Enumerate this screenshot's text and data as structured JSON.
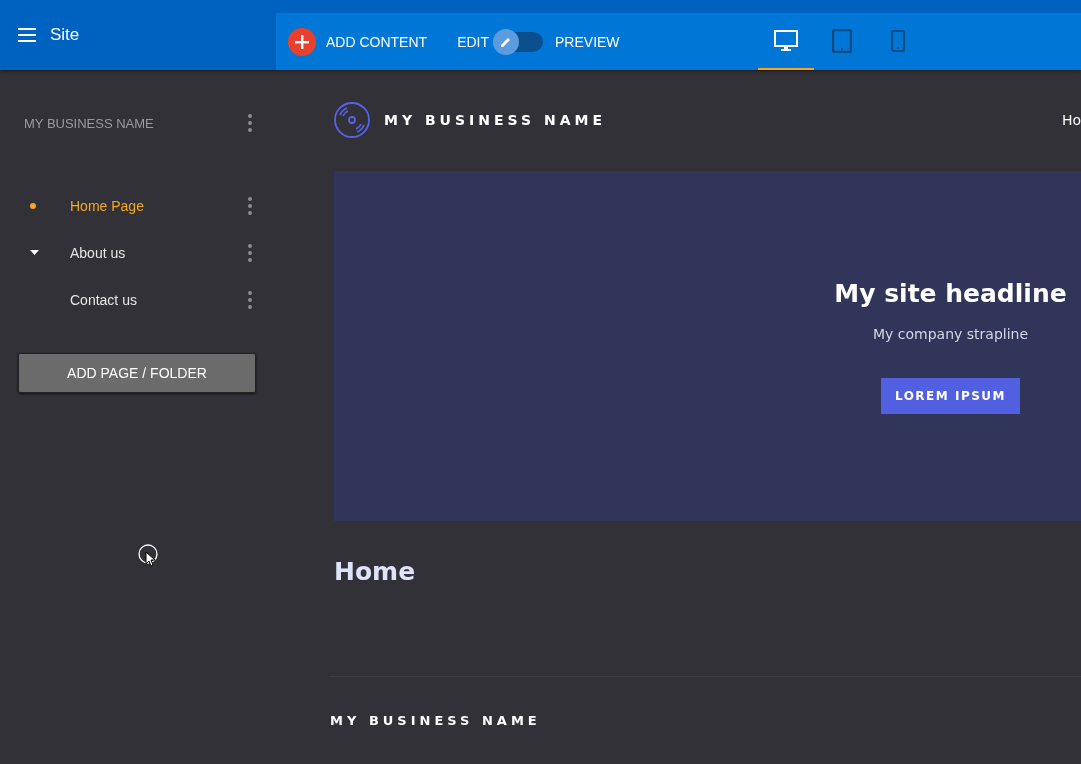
{
  "top_bar": {
    "title": "Site"
  },
  "toolbar": {
    "add_content": "ADD CONTENT",
    "edit_label": "EDIT",
    "preview_label": "PREVIEW",
    "preview_on": false,
    "devices": [
      {
        "kind": "desktop",
        "selected": true
      },
      {
        "kind": "tablet",
        "selected": false
      },
      {
        "kind": "phone",
        "selected": false
      }
    ]
  },
  "sidebar": {
    "site_name": "MY BUSINESS NAME",
    "pages": [
      {
        "label": "Home Page",
        "selected": true
      },
      {
        "label": "About us",
        "selected": false,
        "expanded": true
      },
      {
        "label": "Contact us",
        "selected": false
      }
    ],
    "add_button": "ADD PAGE / FOLDER"
  },
  "preview": {
    "brand": "MY BUSINESS NAME",
    "nav": [
      "Ho"
    ],
    "hero": {
      "headline": "My site headline",
      "strapline": "My company strapline",
      "button": "LOREM IPSUM"
    },
    "page_title": "Home",
    "footer_brand": "MY BUSINESS NAME"
  }
}
